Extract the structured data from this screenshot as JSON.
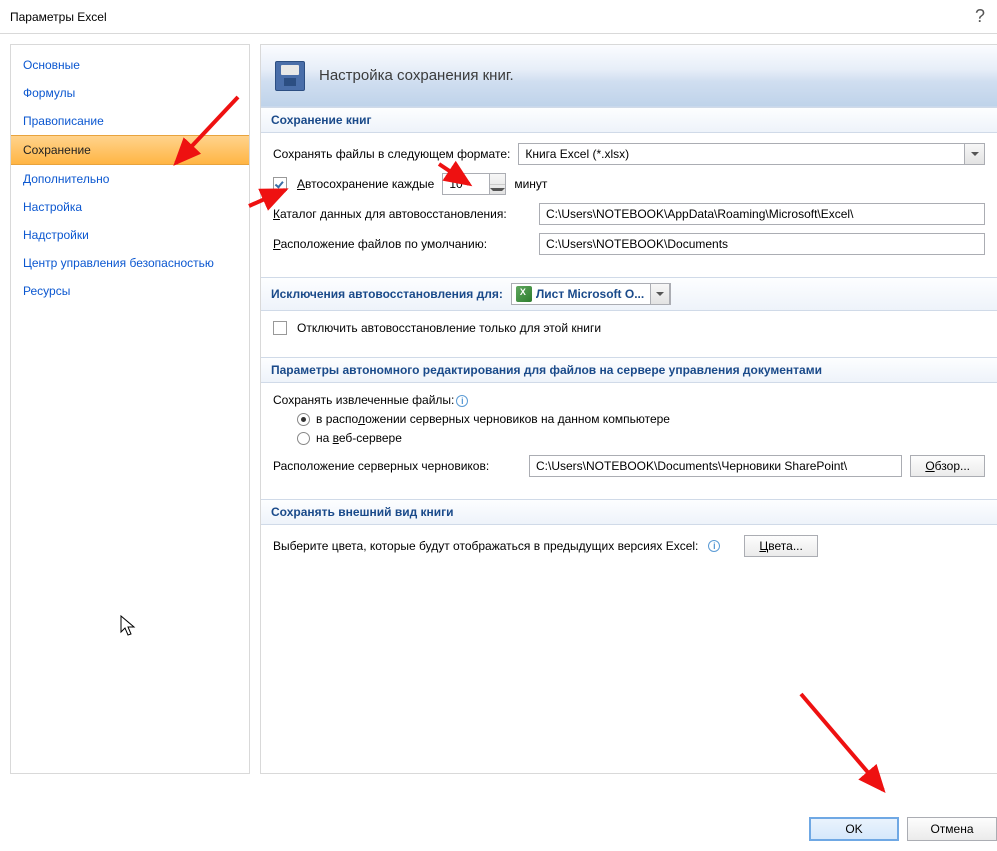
{
  "window": {
    "title": "Параметры Excel",
    "help": "?"
  },
  "sidebar": {
    "items": [
      "Основные",
      "Формулы",
      "Правописание",
      "Сохранение",
      "Дополнительно",
      "Настройка",
      "Надстройки",
      "Центр управления безопасностью",
      "Ресурсы"
    ],
    "selected_index": 3
  },
  "header": {
    "title": "Настройка сохранения книг."
  },
  "sections": {
    "save_books": {
      "title": "Сохранение книг",
      "format_label": "Сохранять файлы в следующем формате:",
      "format_value": "Книга Excel (*.xlsx)",
      "autosave_label": "Автосохранение каждые",
      "autosave_value": "10",
      "minutes_label": "минут",
      "autorecover_dir_label": "Каталог данных для автовосстановления:",
      "autorecover_dir_value": "C:\\Users\\NOTEBOOK\\AppData\\Roaming\\Microsoft\\Excel\\",
      "default_location_label": "Расположение файлов по умолчанию:",
      "default_location_value": "C:\\Users\\NOTEBOOK\\Documents"
    },
    "exceptions": {
      "title": "Исключения автовосстановления для:",
      "workbook_name": "Лист Microsoft O...",
      "disable_label": "Отключить автовосстановление только для этой книги"
    },
    "offline": {
      "title": "Параметры автономного редактирования для файлов на сервере управления документами",
      "save_extracted_label": "Сохранять извлеченные файлы:",
      "radio1": "в расположении серверных черновиков на данном компьютере",
      "radio2": "на веб-сервере",
      "drafts_label": "Расположение серверных черновиков:",
      "drafts_value": "C:\\Users\\NOTEBOOK\\Documents\\Черновики SharePoint\\",
      "browse_btn": "Обзор..."
    },
    "appearance": {
      "title": "Сохранять внешний вид книги",
      "colors_text": "Выберите цвета, которые будут отображаться в предыдущих версиях Excel:",
      "colors_btn": "Цвета..."
    }
  },
  "footer": {
    "ok": "OK",
    "cancel": "Отмена"
  }
}
